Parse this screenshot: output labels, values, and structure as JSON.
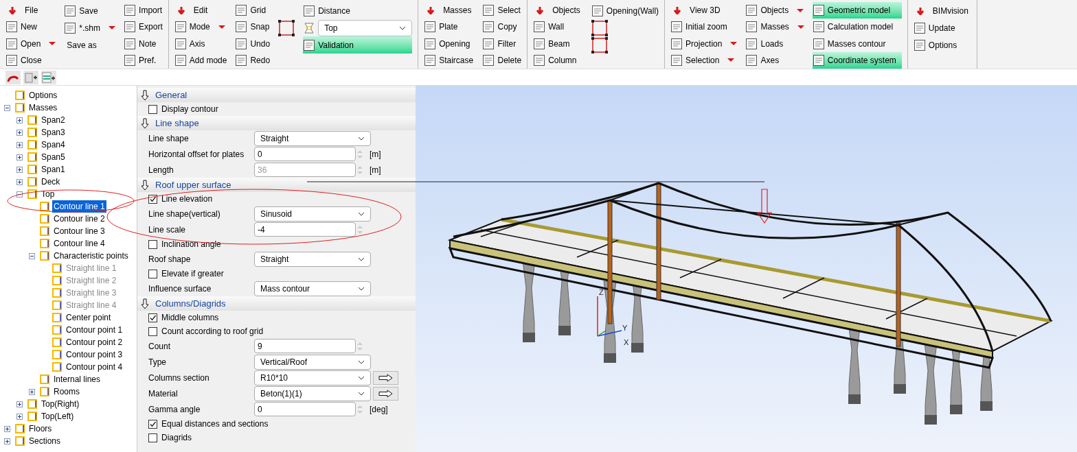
{
  "ribbon": {
    "groups": [
      {
        "columns": [
          [
            {
              "kind": "menu",
              "label": "File"
            },
            {
              "kind": "button",
              "label": "New"
            },
            {
              "kind": "dropdown",
              "label": "Open"
            },
            {
              "kind": "button",
              "label": "Close"
            }
          ],
          [
            {
              "kind": "button",
              "label": "Save"
            },
            {
              "kind": "dropdown",
              "label": "*.shm"
            },
            {
              "kind": "text",
              "label": "Save as"
            }
          ],
          [
            {
              "kind": "button",
              "label": "Import"
            },
            {
              "kind": "button",
              "label": "Export"
            },
            {
              "kind": "button",
              "label": "Note"
            },
            {
              "kind": "button",
              "label": "Pref."
            }
          ]
        ]
      },
      {
        "columns": [
          [
            {
              "kind": "menu",
              "label": "Edit"
            },
            {
              "kind": "dropdown",
              "label": "Mode"
            },
            {
              "kind": "button",
              "label": "Axis"
            },
            {
              "kind": "button",
              "label": "Add mode"
            }
          ],
          [
            {
              "kind": "button",
              "label": "Grid"
            },
            {
              "kind": "button",
              "label": "Snap"
            },
            {
              "kind": "button",
              "label": "Undo"
            },
            {
              "kind": "button",
              "label": "Redo"
            }
          ],
          [
            {
              "kind": "spacer"
            },
            {
              "kind": "icon"
            }
          ],
          [
            {
              "kind": "button",
              "label": "Distance"
            },
            {
              "kind": "combo",
              "label": "Top"
            },
            {
              "kind": "toggle",
              "label": "Validation",
              "on": true
            }
          ]
        ]
      },
      {
        "columns": [
          [
            {
              "kind": "menu",
              "label": "Masses"
            },
            {
              "kind": "button",
              "label": "Plate"
            },
            {
              "kind": "button",
              "label": "Opening"
            },
            {
              "kind": "button",
              "label": "Staircase"
            }
          ],
          [
            {
              "kind": "button",
              "label": "Select"
            },
            {
              "kind": "button",
              "label": "Copy"
            },
            {
              "kind": "button",
              "label": "Filter"
            },
            {
              "kind": "button",
              "label": "Delete"
            }
          ]
        ]
      },
      {
        "columns": [
          [
            {
              "kind": "menu",
              "label": "Objects"
            },
            {
              "kind": "button",
              "label": "Wall"
            },
            {
              "kind": "button",
              "label": "Beam"
            },
            {
              "kind": "button",
              "label": "Column"
            }
          ],
          [
            {
              "kind": "button",
              "label": "Opening(Wall)"
            },
            {
              "kind": "icon"
            },
            {
              "kind": "icon"
            }
          ]
        ]
      },
      {
        "columns": [
          [
            {
              "kind": "menu",
              "label": "View 3D"
            },
            {
              "kind": "button",
              "label": "Initial zoom"
            },
            {
              "kind": "dropdown",
              "label": "Projection"
            },
            {
              "kind": "dropdown",
              "label": "Selection"
            }
          ],
          [
            {
              "kind": "dropdown",
              "label": "Objects"
            },
            {
              "kind": "dropdown",
              "label": "Masses"
            },
            {
              "kind": "button",
              "label": "Loads"
            },
            {
              "kind": "button",
              "label": "Axes"
            }
          ],
          [
            {
              "kind": "toggle",
              "label": "Geometric model",
              "on": true
            },
            {
              "kind": "toggle",
              "label": "Calculation model",
              "on": false
            },
            {
              "kind": "toggle",
              "label": "Masses contour",
              "on": false
            },
            {
              "kind": "toggle",
              "label": "Coordinate system",
              "on": true
            }
          ]
        ]
      },
      {
        "columns": [
          [
            {
              "kind": "menu",
              "label": "BIMvision"
            },
            {
              "kind": "button",
              "label": "Update"
            },
            {
              "kind": "button",
              "label": "Options"
            }
          ]
        ]
      }
    ]
  },
  "tree": {
    "items": [
      {
        "label": "Options",
        "selected": false,
        "disabled": false
      },
      {
        "label": "Masses",
        "expanded": true,
        "selected": false,
        "disabled": false,
        "children": [
          {
            "label": "Span2",
            "expanded": false,
            "selected": false,
            "disabled": false
          },
          {
            "label": "Span3",
            "expanded": false,
            "selected": false,
            "disabled": false
          },
          {
            "label": "Span4",
            "expanded": false,
            "selected": false,
            "disabled": false
          },
          {
            "label": "Span5",
            "expanded": false,
            "selected": false,
            "disabled": false
          },
          {
            "label": "Span1",
            "expanded": false,
            "selected": false,
            "disabled": false
          },
          {
            "label": "Deck",
            "expanded": false,
            "selected": false,
            "disabled": false
          },
          {
            "label": "Top",
            "expanded": true,
            "selected": false,
            "disabled": false,
            "children": [
              {
                "label": "Contour line 1",
                "selected": true,
                "disabled": false
              },
              {
                "label": "Contour line 2",
                "selected": false,
                "disabled": false
              },
              {
                "label": "Contour line 3",
                "selected": false,
                "disabled": false
              },
              {
                "label": "Contour line 4",
                "selected": false,
                "disabled": false
              },
              {
                "label": "Characteristic points",
                "expanded": true,
                "selected": false,
                "disabled": false,
                "children": [
                  {
                    "label": "Straight line 1",
                    "selected": false,
                    "disabled": true
                  },
                  {
                    "label": "Straight line 2",
                    "selected": false,
                    "disabled": true
                  },
                  {
                    "label": "Straight line 3",
                    "selected": false,
                    "disabled": true
                  },
                  {
                    "label": "Straight line 4",
                    "selected": false,
                    "disabled": true
                  },
                  {
                    "label": "Center point",
                    "selected": false,
                    "disabled": false
                  },
                  {
                    "label": "Contour point 1",
                    "selected": false,
                    "disabled": false
                  },
                  {
                    "label": "Contour point 2",
                    "selected": false,
                    "disabled": false
                  },
                  {
                    "label": "Contour point 3",
                    "selected": false,
                    "disabled": false
                  },
                  {
                    "label": "Contour point 4",
                    "selected": false,
                    "disabled": false
                  }
                ]
              },
              {
                "label": "Internal lines",
                "selected": false,
                "disabled": false
              },
              {
                "label": "Rooms",
                "expanded": false,
                "selected": false,
                "disabled": false
              }
            ]
          },
          {
            "label": "Top(Right)",
            "expanded": false,
            "selected": false,
            "disabled": false
          },
          {
            "label": "Top(Left)",
            "expanded": false,
            "selected": false,
            "disabled": false
          }
        ]
      },
      {
        "label": "Floors",
        "expanded": false,
        "selected": false,
        "disabled": false
      },
      {
        "label": "Sections",
        "expanded": false,
        "selected": false,
        "disabled": false
      }
    ]
  },
  "properties": {
    "sections": [
      {
        "title": "General",
        "rows": [
          {
            "kind": "checkbox",
            "label": "Display contour",
            "checked": false
          }
        ]
      },
      {
        "title": "Line shape",
        "rows": [
          {
            "kind": "select",
            "label": "Line shape",
            "value": "Straight"
          },
          {
            "kind": "number",
            "label": "Horizontal offset for plates",
            "value": "0",
            "unit": "[m]",
            "disabled": false
          },
          {
            "kind": "number",
            "label": "Length",
            "value": "36",
            "unit": "[m]",
            "disabled": true
          }
        ]
      },
      {
        "title": "Roof upper surface",
        "rows": [
          {
            "kind": "checkbox",
            "label": "Line elevation",
            "checked": true
          },
          {
            "kind": "select",
            "label": "Line shape(vertical)",
            "value": "Sinusoid"
          },
          {
            "kind": "number",
            "label": "Line scale",
            "value": "-4",
            "disabled": false
          },
          {
            "kind": "checkbox",
            "label": "Inclination angle",
            "checked": false
          },
          {
            "kind": "select",
            "label": "Roof shape",
            "value": "Straight"
          },
          {
            "kind": "checkbox",
            "label": "Elevate if greater",
            "checked": false
          },
          {
            "kind": "select",
            "label": "Influence surface",
            "value": "Mass contour"
          }
        ]
      },
      {
        "title": "Columns/Diagrids",
        "rows": [
          {
            "kind": "checkbox",
            "label": "Middle columns",
            "checked": true
          },
          {
            "kind": "checkbox",
            "label": "Count according to roof grid",
            "checked": false
          },
          {
            "kind": "number",
            "label": "Count",
            "value": "9",
            "disabled": false
          },
          {
            "kind": "select",
            "label": "Type",
            "value": "Vertical/Roof"
          },
          {
            "kind": "select_link",
            "label": "Columns section",
            "value": "R10*10"
          },
          {
            "kind": "select_link",
            "label": "Material",
            "value": "Beton(1)(1)"
          },
          {
            "kind": "number",
            "label": "Gamma angle",
            "value": "0",
            "unit": "[deg]",
            "disabled": false
          },
          {
            "kind": "checkbox",
            "label": "Equal distances and sections",
            "checked": true
          },
          {
            "kind": "checkbox",
            "label": "Diagrids",
            "checked": false
          }
        ]
      }
    ]
  },
  "view": {
    "axis_labels": [
      "Z",
      "Y",
      "X"
    ]
  }
}
